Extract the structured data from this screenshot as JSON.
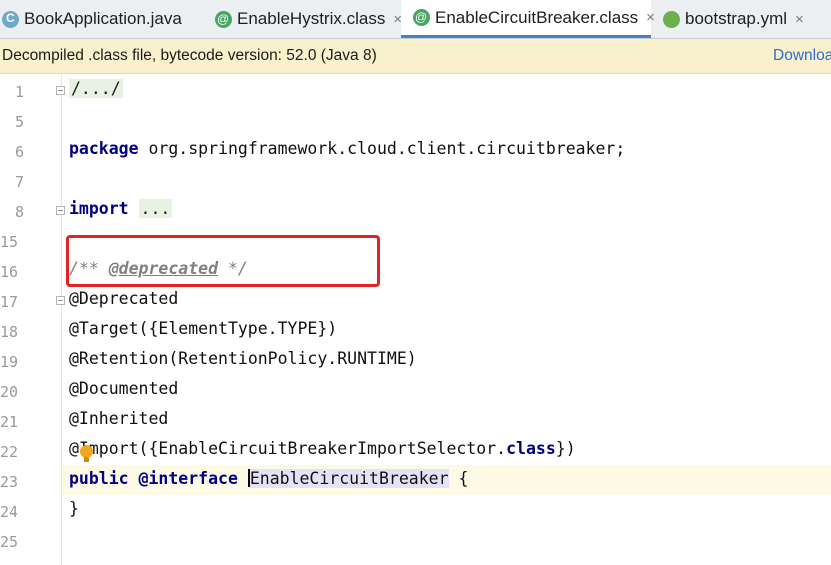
{
  "tabs": [
    {
      "label": "BookApplication.java",
      "icon": "class-c-icon",
      "active": false
    },
    {
      "label": "EnableHystrix.class",
      "icon": "annotation-icon",
      "active": false
    },
    {
      "label": "EnableCircuitBreaker.class",
      "icon": "annotation-icon",
      "active": true
    },
    {
      "label": "bootstrap.yml",
      "icon": "spring-leaf-icon",
      "active": false
    }
  ],
  "close_glyph": "×",
  "banner": {
    "text": "Decompiled .class file, bytecode version: 52.0 (Java 8)",
    "link": "Downloa"
  },
  "line_numbers": [
    "1",
    "5",
    "6",
    "7",
    "8",
    "15",
    "16",
    "17",
    "18",
    "19",
    "20",
    "21",
    "22",
    "23",
    "24",
    "25"
  ],
  "code": {
    "l1": "/.../",
    "l6_kw": "package",
    "l6_rest": " org.springframework.cloud.client.circuitbreaker;",
    "l8_kw": "import",
    "l8_fold": "...",
    "l16_open": "/** ",
    "l16_tag": "@deprecated",
    "l16_close": " */",
    "l17": "@Deprecated",
    "l18": "@Target({ElementType.TYPE})",
    "l19_ann": "@Retention",
    "l19_rest": "(RetentionPolicy.RUNTIME)",
    "l20": "@Documented",
    "l21": "@Inherited",
    "l22_ann": "@Import",
    "l22_mid": "({EnableCircuitBreakerImportSelector.",
    "l22_kw": "class",
    "l22_end": "})",
    "l23_kw1": "public",
    "l23_kw2": "@interface",
    "l23_name": "EnableCircuitBreaker",
    "l23_brace": " {",
    "l24": "}"
  },
  "colors": {
    "keyword": "#000080",
    "annotation": "#808000",
    "comment": "#808080",
    "highlight_box": "#e12323",
    "link": "#2f6bd1"
  }
}
